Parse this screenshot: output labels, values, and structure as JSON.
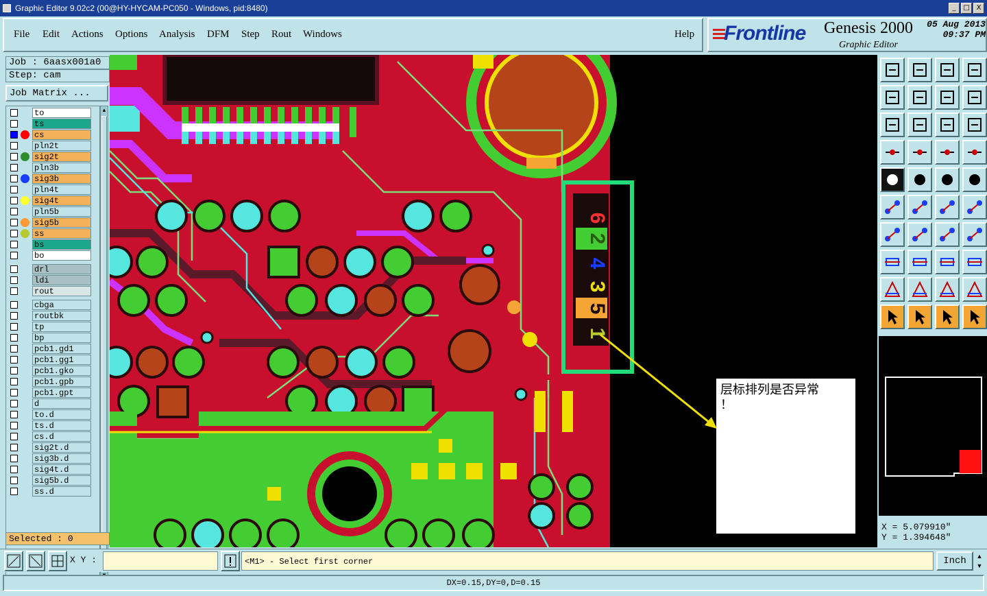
{
  "window": {
    "title": "Graphic Editor 9.02c2 (00@HY-HYCAM-PC050 - Windows, pid:8480)",
    "controls": [
      "_",
      "□",
      "X"
    ]
  },
  "menu": {
    "items": [
      "File",
      "Edit",
      "Actions",
      "Options",
      "Analysis",
      "DFM",
      "Step",
      "Rout",
      "Windows"
    ],
    "help": "Help"
  },
  "brand": {
    "logo": "Frontline",
    "product": "Genesis 2000",
    "subtitle": "Graphic Editor",
    "date": "05 Aug 2013",
    "time": "09:37 PM"
  },
  "job": {
    "job_line": "Job : 6aasx001a0",
    "step_line": "Step: cam",
    "matrix_button": "Job Matrix ..."
  },
  "layers": [
    {
      "name": "to",
      "bg": "#ffffff",
      "dot": "",
      "checked": false
    },
    {
      "name": "ts",
      "bg": "#1aa88a",
      "dot": "",
      "checked": false
    },
    {
      "name": "cs",
      "bg": "#f5b05a",
      "dot": "#ff0000",
      "checked": true
    },
    {
      "name": "pln2t",
      "bg": "#bfe3e8",
      "dot": "",
      "checked": false
    },
    {
      "name": "sig2t",
      "bg": "#f5b05a",
      "dot": "#2e8b2e",
      "checked": false
    },
    {
      "name": "pln3b",
      "bg": "#bfe3e8",
      "dot": "",
      "checked": false
    },
    {
      "name": "sig3b",
      "bg": "#f5b05a",
      "dot": "#1a3cff",
      "checked": false
    },
    {
      "name": "pln4t",
      "bg": "#bfe3e8",
      "dot": "",
      "checked": false
    },
    {
      "name": "sig4t",
      "bg": "#f5b05a",
      "dot": "#ffff33",
      "checked": false
    },
    {
      "name": "pln5b",
      "bg": "#bfe3e8",
      "dot": "",
      "checked": false
    },
    {
      "name": "sig5b",
      "bg": "#f5b05a",
      "dot": "#ff9933",
      "checked": false
    },
    {
      "name": "ss",
      "bg": "#f5b05a",
      "dot": "#b8c830",
      "checked": false
    },
    {
      "name": "bs",
      "bg": "#1aa88a",
      "dot": "",
      "checked": false
    },
    {
      "name": "bo",
      "bg": "#ffffff",
      "dot": "",
      "checked": false
    },
    {
      "name": "drl",
      "bg": "#a9c0c4",
      "dot": "",
      "checked": false
    },
    {
      "name": "ldi",
      "bg": "#a9c0c4",
      "dot": "",
      "checked": false
    },
    {
      "name": "rout",
      "bg": "#d9e6e8",
      "dot": "",
      "checked": false
    },
    {
      "name": "cbga",
      "bg": "#bfe3e8",
      "dot": "",
      "checked": false
    },
    {
      "name": "routbk",
      "bg": "#bfe3e8",
      "dot": "",
      "checked": false
    },
    {
      "name": "tp",
      "bg": "#bfe3e8",
      "dot": "",
      "checked": false
    },
    {
      "name": "bp",
      "bg": "#bfe3e8",
      "dot": "",
      "checked": false
    },
    {
      "name": "pcb1.gd1",
      "bg": "#bfe3e8",
      "dot": "",
      "checked": false
    },
    {
      "name": "pcb1.gg1",
      "bg": "#bfe3e8",
      "dot": "",
      "checked": false
    },
    {
      "name": "pcb1.gko",
      "bg": "#bfe3e8",
      "dot": "",
      "checked": false
    },
    {
      "name": "pcb1.gpb",
      "bg": "#bfe3e8",
      "dot": "",
      "checked": false
    },
    {
      "name": "pcb1.gpt",
      "bg": "#bfe3e8",
      "dot": "",
      "checked": false
    },
    {
      "name": "d",
      "bg": "#bfe3e8",
      "dot": "",
      "checked": false
    },
    {
      "name": "to.d",
      "bg": "#bfe3e8",
      "dot": "",
      "checked": false
    },
    {
      "name": "ts.d",
      "bg": "#bfe3e8",
      "dot": "",
      "checked": false
    },
    {
      "name": "cs.d",
      "bg": "#bfe3e8",
      "dot": "",
      "checked": false
    },
    {
      "name": "sig2t.d",
      "bg": "#bfe3e8",
      "dot": "",
      "checked": false
    },
    {
      "name": "sig3b.d",
      "bg": "#bfe3e8",
      "dot": "",
      "checked": false
    },
    {
      "name": "sig4t.d",
      "bg": "#bfe3e8",
      "dot": "",
      "checked": false
    },
    {
      "name": "sig5b.d",
      "bg": "#bfe3e8",
      "dot": "",
      "checked": false
    },
    {
      "name": "ss.d",
      "bg": "#bfe3e8",
      "dot": "",
      "checked": false
    }
  ],
  "selected": "Selected : 0",
  "annotation": {
    "text_line1": "层标排列是否异常",
    "text_line2": "！"
  },
  "layer_marks": [
    "6",
    "2",
    "4",
    "3",
    "5",
    "1"
  ],
  "coords": {
    "x": "X = 5.079910\"",
    "y": "Y = 1.394648\""
  },
  "command": {
    "xy_label": "X Y :",
    "xy_value": "",
    "prompt": "<M1> - Select first corner",
    "unit": "Inch"
  },
  "status": "DX=0.15,DY=0,D=0.15",
  "colors": {
    "board_red": "#c8102e",
    "copper_green": "#44cc33",
    "pad_cyan": "#55e6e0",
    "via_brown": "#b5441a",
    "accent_yellow": "#f0e000"
  }
}
